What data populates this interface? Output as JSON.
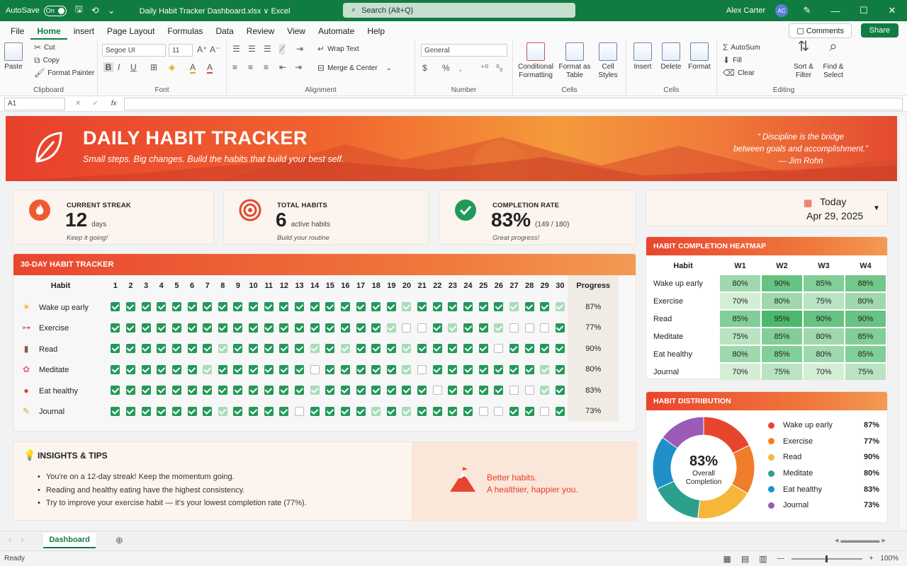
{
  "window": {
    "autosave_label": "AutoSave",
    "autosave_state": "On",
    "doc_title": "Daily Habit Tracker Dashboard.xlsx  ∨  Excel",
    "search_placeholder": "Search (Alt+Q)",
    "user": "Alex Carter",
    "user_initials": "AC"
  },
  "menu": {
    "items": [
      "File",
      "Home",
      "insert",
      "Page Layout",
      "Formulas",
      "Data",
      "Review",
      "View",
      "Automate",
      "Help"
    ],
    "active": "Home",
    "comments": "Comments",
    "share": "Share"
  },
  "ribbon": {
    "clipboard": {
      "paste": "Paste",
      "cut": "Cut",
      "copy": "Copy",
      "format_painter": "Format Painter",
      "label": "Clipboard"
    },
    "font": {
      "name": "Segoe UI",
      "size": "11",
      "label": "Font"
    },
    "alignment": {
      "wrap": "Wrap Text",
      "merge": "Merge & Center",
      "label": "Alignment"
    },
    "number": {
      "format": "General",
      "label": "Number"
    },
    "styles": {
      "conditional": "Conditional Formatting",
      "format_table": "Format as Table",
      "cell_styles": "Cell Styles",
      "label": "Cells"
    },
    "cells": {
      "insert": "Insert",
      "delete": "Delete",
      "format": "Format",
      "label": "Cells"
    },
    "editing": {
      "autosum": "AutoSum",
      "fill": "Fill",
      "clear": "Clear",
      "sort": "Sort & Filter",
      "find": "Find & Select",
      "label": "Editing"
    }
  },
  "formula": {
    "namebox": "A1",
    "fx": "fx"
  },
  "banner": {
    "title": "DAILY HABIT TRACKER",
    "subtitle": "Small steps. Big changes. Build the habits that build your best self.",
    "quote_line1": "“ Discipline is the bridge",
    "quote_line2": "between goals and accomplishment.”",
    "quote_author": "— Jim Rohn"
  },
  "kpis": [
    {
      "label": "CURRENT STREAK",
      "value": "12",
      "unit": "days",
      "note": "Keep it going!"
    },
    {
      "label": "TOTAL HABITS",
      "value": "6",
      "unit": "active habits",
      "note": "Build your routine"
    },
    {
      "label": "COMPLETION RATE",
      "value": "83%",
      "unit": "(149 / 180)",
      "note": "Great progress!"
    }
  ],
  "today": {
    "label": "Today",
    "date": "Apr 29, 2025"
  },
  "tracker": {
    "title": "30-DAY HABIT TRACKER",
    "habit_header": "Habit",
    "progress_header": "Progress",
    "days": [
      "1",
      "2",
      "3",
      "4",
      "5",
      "6",
      "7",
      "8",
      "9",
      "10",
      "11",
      "12",
      "13",
      "14",
      "15",
      "16",
      "17",
      "18",
      "19",
      "20",
      "21",
      "22",
      "23",
      "24",
      "25",
      "26",
      "27",
      "28",
      "29",
      "30"
    ],
    "habits": [
      {
        "name": "Wake up early",
        "icon": "sun-icon",
        "glyph": "☀",
        "color": "#f4a51c",
        "progress": "87%",
        "days": "111111111111111111121111112112"
      },
      {
        "name": "Exercise",
        "icon": "dumbbell-icon",
        "glyph": "⊶",
        "color": "#d9534f",
        "progress": "77%",
        "days": "111111111111111111200121120001"
      },
      {
        "name": "Read",
        "icon": "book-icon",
        "glyph": "▮",
        "color": "#8a5a3c",
        "progress": "90%",
        "days": "111111121111121211121111101111"
      },
      {
        "name": "Meditate",
        "icon": "lotus-icon",
        "glyph": "✿",
        "color": "#e0668a",
        "progress": "80%",
        "days": "111111211111101111120111111121"
      },
      {
        "name": "Eat healthy",
        "icon": "apple-icon",
        "glyph": "●",
        "color": "#e03a2a",
        "progress": "83%",
        "days": "111111111111121111111011110021"
      },
      {
        "name": "Journal",
        "icon": "pencil-icon",
        "glyph": "✎",
        "color": "#e2a11f",
        "progress": "73%",
        "days": "111111121111011112121111001101"
      }
    ]
  },
  "insights": {
    "title": "INSIGHTS & TIPS",
    "tips": [
      "You're on a 12-day streak! Keep the momentum going.",
      "Reading and healthy eating have the highest consistency.",
      "Try to improve your exercise habit — it's your lowest completion rate (77%)."
    ],
    "slogan1": "Better habits.",
    "slogan2": "A healthier, happier you."
  },
  "heatmap": {
    "title": "HABIT COMPLETION HEATMAP",
    "habit_header": "Habit",
    "weeks": [
      "W1",
      "W2",
      "W3",
      "W4"
    ],
    "rows": [
      {
        "name": "Wake up early",
        "values": [
          "80%",
          "90%",
          "85%",
          "88%"
        ]
      },
      {
        "name": "Exercise",
        "values": [
          "70%",
          "80%",
          "75%",
          "80%"
        ]
      },
      {
        "name": "Read",
        "values": [
          "85%",
          "95%",
          "90%",
          "90%"
        ]
      },
      {
        "name": "Meditate",
        "values": [
          "75%",
          "85%",
          "80%",
          "85%"
        ]
      },
      {
        "name": "Eat healthy",
        "values": [
          "80%",
          "85%",
          "80%",
          "85%"
        ]
      },
      {
        "name": "Journal",
        "values": [
          "70%",
          "75%",
          "70%",
          "75%"
        ]
      }
    ]
  },
  "chart_data": {
    "type": "pie",
    "title": "HABIT DISTRIBUTION",
    "center_value": "83%",
    "center_label": "Overall Completion",
    "categories": [
      "Wake up early",
      "Exercise",
      "Read",
      "Meditate",
      "Eat healthy",
      "Journal"
    ],
    "values": [
      87,
      77,
      90,
      80,
      83,
      73
    ],
    "labels": [
      "87%",
      "77%",
      "90%",
      "80%",
      "83%",
      "73%"
    ],
    "colors": [
      "#e8452f",
      "#f07d2a",
      "#f6b63a",
      "#2ca08d",
      "#1f8fc8",
      "#9b5bb7"
    ]
  },
  "sheet_tabs": {
    "active": "Dashboard"
  },
  "status": {
    "ready": "Ready",
    "zoom": "100%"
  }
}
